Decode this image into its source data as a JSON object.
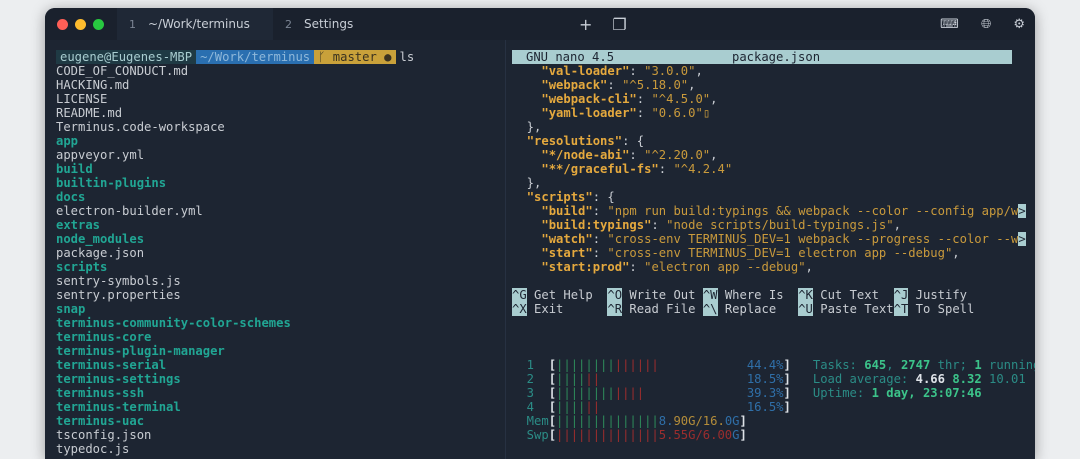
{
  "window": {
    "tabs": [
      {
        "num": "1",
        "label": "~/Work/terminus"
      },
      {
        "num": "2",
        "label": "Settings"
      }
    ],
    "new_tab": "+",
    "icons": [
      "keyboard-icon",
      "globe-icon",
      "gear-icon"
    ]
  },
  "colors": {
    "bg": "#1d2532",
    "dir": "#21a694",
    "nano_header": "#a9cdd0"
  },
  "left": {
    "prompt": {
      "user": "eugene@Eugenes-MBP",
      "path": "~/Work/terminus",
      "branch": "ᚴ master ●",
      "cmd": "ls"
    },
    "files": [
      {
        "t": "CODE_OF_CONDUCT.md",
        "d": false
      },
      {
        "t": "HACKING.md",
        "d": false
      },
      {
        "t": "LICENSE",
        "d": false
      },
      {
        "t": "README.md",
        "d": false
      },
      {
        "t": "Terminus.code-workspace",
        "d": false
      },
      {
        "t": "app",
        "d": true
      },
      {
        "t": "appveyor.yml",
        "d": false
      },
      {
        "t": "build",
        "d": true
      },
      {
        "t": "builtin-plugins",
        "d": true
      },
      {
        "t": "docs",
        "d": true
      },
      {
        "t": "electron-builder.yml",
        "d": false
      },
      {
        "t": "extras",
        "d": true
      },
      {
        "t": "node_modules",
        "d": true
      },
      {
        "t": "package.json",
        "d": false
      },
      {
        "t": "scripts",
        "d": true
      },
      {
        "t": "sentry-symbols.js",
        "d": false
      },
      {
        "t": "sentry.properties",
        "d": false
      },
      {
        "t": "snap",
        "d": true
      },
      {
        "t": "terminus-community-color-schemes",
        "d": true
      },
      {
        "t": "terminus-core",
        "d": true
      },
      {
        "t": "terminus-plugin-manager",
        "d": true
      },
      {
        "t": "terminus-serial",
        "d": true
      },
      {
        "t": "terminus-settings",
        "d": true
      },
      {
        "t": "terminus-ssh",
        "d": true
      },
      {
        "t": "terminus-terminal",
        "d": true
      },
      {
        "t": "terminus-uac",
        "d": true
      },
      {
        "t": "tsconfig.json",
        "d": false
      },
      {
        "t": "typedoc.js",
        "d": false
      }
    ]
  },
  "nano": {
    "app": "GNU nano 4.5",
    "file": "package.json",
    "lines": [
      [
        [
          "    ",
          "w"
        ],
        [
          "\"val-loader\"",
          "k"
        ],
        [
          ": ",
          "w"
        ],
        [
          "\"3.0.0\"",
          "s"
        ],
        [
          ",",
          "w"
        ]
      ],
      [
        [
          "    ",
          "w"
        ],
        [
          "\"webpack\"",
          "k"
        ],
        [
          ": ",
          "w"
        ],
        [
          "\"^5.18.0\"",
          "s"
        ],
        [
          ",",
          "w"
        ]
      ],
      [
        [
          "    ",
          "w"
        ],
        [
          "\"webpack-cli\"",
          "k"
        ],
        [
          ": ",
          "w"
        ],
        [
          "\"^4.5.0\"",
          "s"
        ],
        [
          ",",
          "w"
        ]
      ],
      [
        [
          "    ",
          "w"
        ],
        [
          "\"yaml-loader\"",
          "k"
        ],
        [
          ": ",
          "w"
        ],
        [
          "\"0.6.0\"",
          "s"
        ],
        [
          "▯",
          "s"
        ]
      ],
      [
        [
          "  },",
          "w"
        ]
      ],
      [
        [
          "  ",
          "w"
        ],
        [
          "\"resolutions\"",
          "k"
        ],
        [
          ": {",
          "w"
        ]
      ],
      [
        [
          "    ",
          "w"
        ],
        [
          "\"*/node-abi\"",
          "k"
        ],
        [
          ": ",
          "w"
        ],
        [
          "\"^2.20.0\"",
          "s"
        ],
        [
          ",",
          "w"
        ]
      ],
      [
        [
          "    ",
          "w"
        ],
        [
          "\"**/graceful-fs\"",
          "k"
        ],
        [
          ": ",
          "w"
        ],
        [
          "\"^4.2.4\"",
          "s"
        ]
      ],
      [
        [
          "  },",
          "w"
        ]
      ],
      [
        [
          "  ",
          "w"
        ],
        [
          "\"scripts\"",
          "k"
        ],
        [
          ": {",
          "w"
        ]
      ],
      [
        [
          "    ",
          "w"
        ],
        [
          "\"build\"",
          "k"
        ],
        [
          ": ",
          "w"
        ],
        [
          "\"npm run build:typings && webpack --color --config app/w",
          "s"
        ],
        [
          ">",
          "key"
        ]
      ],
      [
        [
          "    ",
          "w"
        ],
        [
          "\"build:typings\"",
          "k"
        ],
        [
          ": ",
          "w"
        ],
        [
          "\"node scripts/build-typings.js\"",
          "s"
        ],
        [
          ",",
          "w"
        ]
      ],
      [
        [
          "    ",
          "w"
        ],
        [
          "\"watch\"",
          "k"
        ],
        [
          ": ",
          "w"
        ],
        [
          "\"cross-env TERMINUS_DEV=1 webpack --progress --color --w",
          "s"
        ],
        [
          ">",
          "key"
        ]
      ],
      [
        [
          "    ",
          "w"
        ],
        [
          "\"start\"",
          "k"
        ],
        [
          ": ",
          "w"
        ],
        [
          "\"cross-env TERMINUS_DEV=1 electron app --debug\"",
          "s"
        ],
        [
          ",",
          "w"
        ]
      ],
      [
        [
          "    ",
          "w"
        ],
        [
          "\"start:prod\"",
          "k"
        ],
        [
          ": ",
          "w"
        ],
        [
          "\"electron app --debug\"",
          "s"
        ],
        [
          ",",
          "w"
        ]
      ]
    ],
    "shortcuts": [
      [
        [
          "^G",
          "key"
        ],
        [
          " Get Help  ",
          "p"
        ],
        [
          "^O",
          "key"
        ],
        [
          " Write Out ",
          "p"
        ],
        [
          "^W",
          "key"
        ],
        [
          " Where Is  ",
          "p"
        ],
        [
          "^K",
          "key"
        ],
        [
          " Cut Text  ",
          "p"
        ],
        [
          "^J",
          "key"
        ],
        [
          " Justify",
          "p"
        ]
      ],
      [
        [
          "^X",
          "key"
        ],
        [
          " Exit      ",
          "p"
        ],
        [
          "^R",
          "key"
        ],
        [
          " Read File ",
          "p"
        ],
        [
          "^\\",
          "key"
        ],
        [
          " Replace   ",
          "p"
        ],
        [
          "^U",
          "key"
        ],
        [
          " Paste Text",
          "p"
        ],
        [
          "^T",
          "key"
        ],
        [
          " To Spell",
          "p"
        ]
      ]
    ]
  },
  "htop": {
    "lines": [
      [
        [
          "  1  ",
          "t"
        ],
        [
          "[",
          "bw"
        ],
        [
          "||||||||",
          "gr"
        ],
        [
          "||||||",
          "r"
        ],
        [
          "            ",
          "w"
        ],
        [
          "44.4%",
          "b"
        ],
        [
          "]",
          "bw"
        ],
        [
          "   Tasks: ",
          "t"
        ],
        [
          "645",
          "g"
        ],
        [
          ", ",
          "t"
        ],
        [
          "2747",
          "g"
        ],
        [
          " thr; ",
          "t"
        ],
        [
          "1",
          "g"
        ],
        [
          " running",
          "t"
        ]
      ],
      [
        [
          "  2  ",
          "t"
        ],
        [
          "[",
          "bw"
        ],
        [
          "||||",
          "gr"
        ],
        [
          "||",
          "r"
        ],
        [
          "                    ",
          "w"
        ],
        [
          "18.5%",
          "b"
        ],
        [
          "]",
          "bw"
        ],
        [
          "   Load average: ",
          "t"
        ],
        [
          "4.66",
          "bw"
        ],
        [
          " ",
          "t"
        ],
        [
          "8.32",
          "g"
        ],
        [
          " 10.01",
          "t"
        ]
      ],
      [
        [
          "  3  ",
          "t"
        ],
        [
          "[",
          "bw"
        ],
        [
          "||||||||",
          "gr"
        ],
        [
          "||||",
          "r"
        ],
        [
          "              ",
          "w"
        ],
        [
          "39.3%",
          "b"
        ],
        [
          "]",
          "bw"
        ],
        [
          "   Uptime: ",
          "t"
        ],
        [
          "1 day, 23:07:46",
          "g"
        ]
      ],
      [
        [
          "  4  ",
          "t"
        ],
        [
          "[",
          "bw"
        ],
        [
          "||||",
          "gr"
        ],
        [
          "||",
          "r"
        ],
        [
          "                    ",
          "w"
        ],
        [
          "16.5%",
          "b"
        ],
        [
          "]",
          "bw"
        ]
      ],
      [
        [
          "  Mem",
          "t"
        ],
        [
          "[",
          "bw"
        ],
        [
          "||||||||||||||",
          "gr"
        ],
        [
          "8.",
          "b"
        ],
        [
          "90G/16.",
          "y"
        ],
        [
          "0G",
          "b"
        ],
        [
          "]",
          "bw"
        ]
      ],
      [
        [
          "  Swp",
          "t"
        ],
        [
          "[",
          "bw"
        ],
        [
          "||||||||||||||",
          "r"
        ],
        [
          "5.55G/6.00",
          "r"
        ],
        [
          "G",
          "b"
        ],
        [
          "]",
          "bw"
        ]
      ]
    ]
  }
}
